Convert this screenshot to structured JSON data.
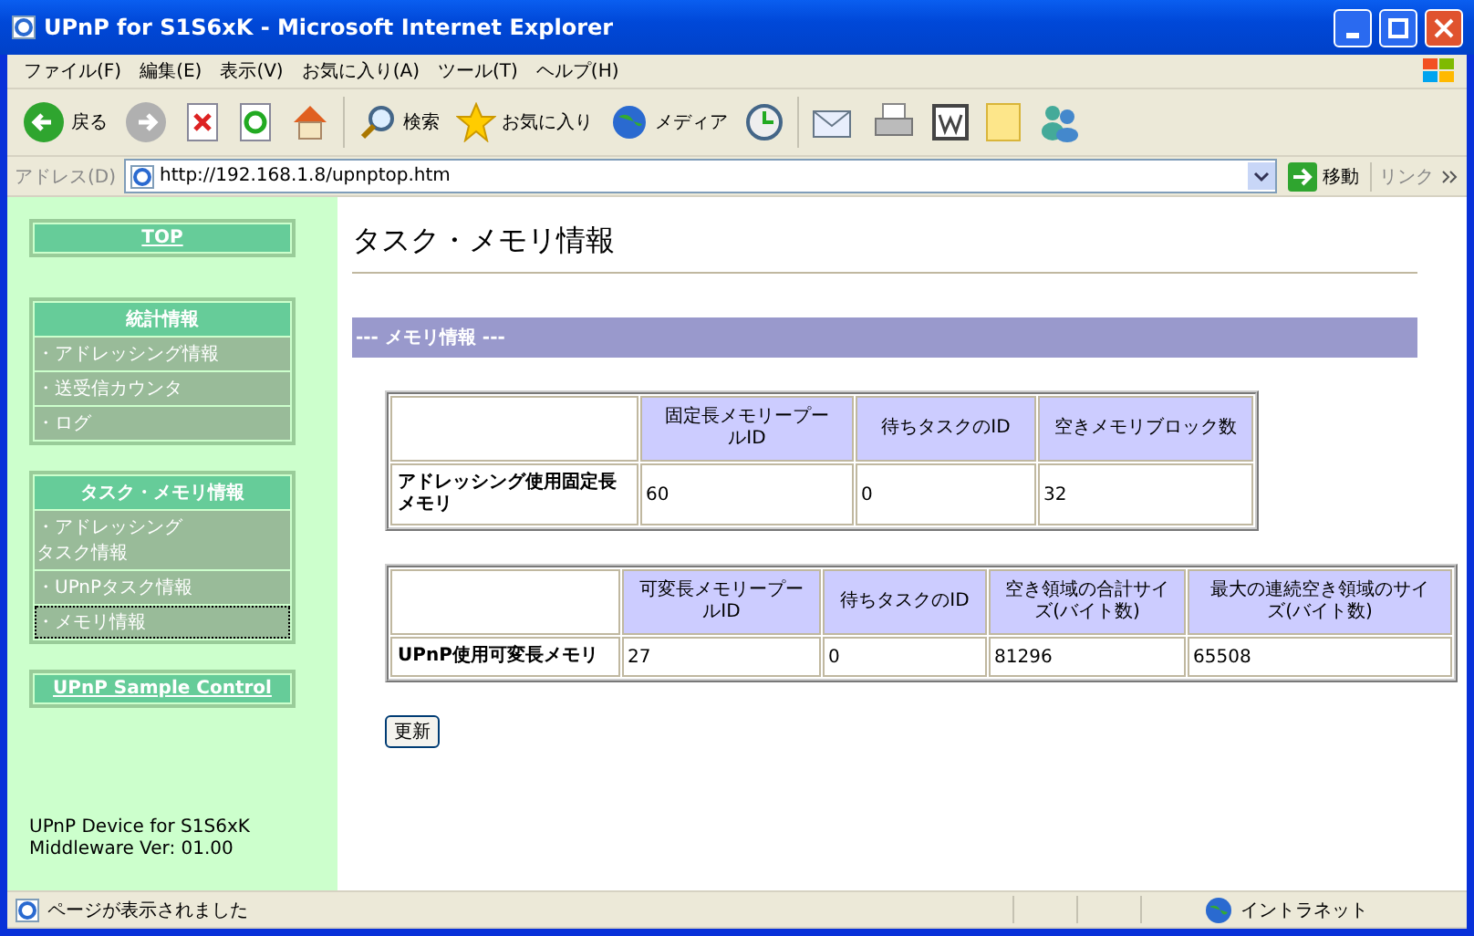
{
  "window": {
    "title": "UPnP for S1S6xK - Microsoft Internet Explorer"
  },
  "menu_bar": [
    "ファイル(F)",
    "編集(E)",
    "表示(V)",
    "お気に入り(A)",
    "ツール(T)",
    "ヘルプ(H)"
  ],
  "toolbar": {
    "back_label": "戻る",
    "search_label": "検索",
    "favorites_label": "お気に入り",
    "media_label": "メディア"
  },
  "address_bar": {
    "label": "アドレス(D)",
    "url": "http://192.168.1.8/upnptop.htm",
    "go_label": "移動",
    "links_label": "リンク"
  },
  "sidebar": {
    "sections": [
      {
        "kind": "link",
        "label": "TOP"
      },
      {
        "kind": "menu",
        "title": "統計情報",
        "items": [
          {
            "lines": [
              "・アドレッシング情報"
            ],
            "selected": false
          },
          {
            "lines": [
              "・送受信カウンタ"
            ],
            "selected": false
          },
          {
            "lines": [
              "・ログ"
            ],
            "selected": false
          }
        ]
      },
      {
        "kind": "menu",
        "title": "タスク・メモリ情報",
        "items": [
          {
            "lines": [
              "・アドレッシング",
              "タスク情報"
            ],
            "selected": false
          },
          {
            "lines": [
              "・UPnPタスク情報"
            ],
            "selected": false
          },
          {
            "lines": [
              "・メモリ情報"
            ],
            "selected": true
          }
        ]
      },
      {
        "kind": "link",
        "label": "UPnP Sample Control"
      }
    ],
    "footer": [
      "UPnP Device for S1S6xK",
      "Middleware Ver: 01.00"
    ]
  },
  "main": {
    "heading": "タスク・メモリ情報",
    "section_title": "--- メモリ情報 ---",
    "tables": [
      {
        "columns": [
          "固定長メモリープールID",
          "待ちタスクのID",
          "空きメモリブロック数"
        ],
        "rows": [
          {
            "header": "アドレッシング使用固定長メモリ",
            "cells": [
              "60",
              "0",
              "32"
            ]
          }
        ]
      },
      {
        "columns": [
          "可変長メモリープールID",
          "待ちタスクのID",
          "空き領域の合計サイズ(バイト数)",
          "最大の連続空き領域のサイズ(バイト数)"
        ],
        "rows": [
          {
            "header": "UPnP使用可変長メモリ",
            "cells": [
              "27",
              "0",
              "81296",
              "65508"
            ]
          }
        ]
      }
    ],
    "refresh_button": "更新"
  },
  "status_bar": {
    "text": "ページが表示されました",
    "zone": "イントラネット"
  }
}
